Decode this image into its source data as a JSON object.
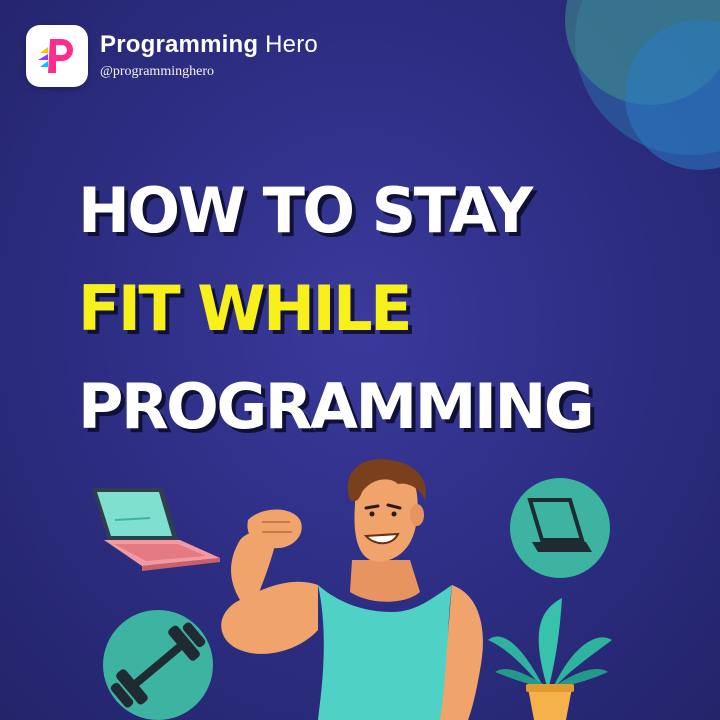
{
  "brand": {
    "name_bold": "Programming",
    "name_light": "Hero",
    "handle": "@programminghero",
    "logo_icon": "programming-hero-logo-icon"
  },
  "headline": {
    "line1": "HOW TO STAY",
    "line2": "FIT WHILE",
    "line3": "PROGRAMMING"
  },
  "colors": {
    "background": "#2e2f86",
    "accent_yellow": "#f7f01a",
    "teal": "#3db3a2",
    "skin": "#f0a36b"
  },
  "illustration": {
    "items": [
      "laptop-icon",
      "dumbbell-icon",
      "laptop-circle-icon",
      "plant-icon",
      "muscle-man-illustration"
    ]
  }
}
